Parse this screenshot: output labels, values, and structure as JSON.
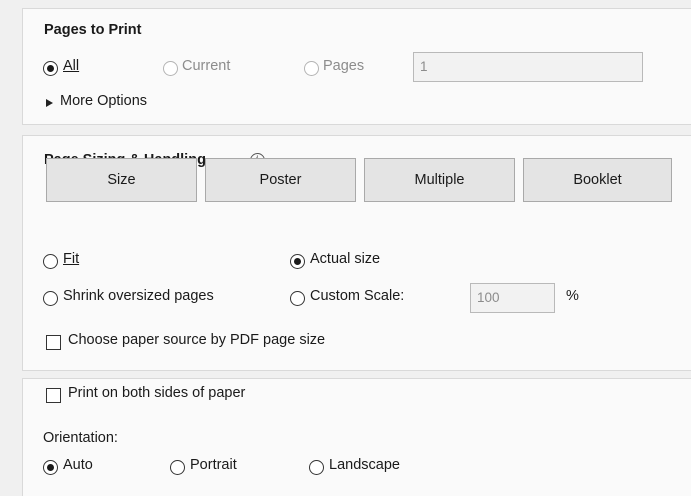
{
  "pages_to_print": {
    "title": "Pages to Print",
    "all_label": "All",
    "current_label": "Current",
    "pages_label": "Pages",
    "pages_value": "1",
    "more_options_label": "More Options",
    "selected": "All"
  },
  "page_sizing": {
    "title": "Page Sizing & Handling",
    "info_glyph": "i",
    "buttons": [
      "Size",
      "Poster",
      "Multiple",
      "Booklet"
    ],
    "fit_label": "Fit",
    "actual_size_label": "Actual size",
    "shrink_label": "Shrink oversized pages",
    "custom_scale_label": "Custom Scale:",
    "custom_scale_value": "100",
    "percent_label": "%",
    "paper_source_label": "Choose paper source by PDF page size",
    "selected": "Actual size"
  },
  "orientation": {
    "both_sides_label": "Print on both sides of paper",
    "title": "Orientation:",
    "auto_label": "Auto",
    "portrait_label": "Portrait",
    "landscape_label": "Landscape",
    "selected": "Auto"
  }
}
